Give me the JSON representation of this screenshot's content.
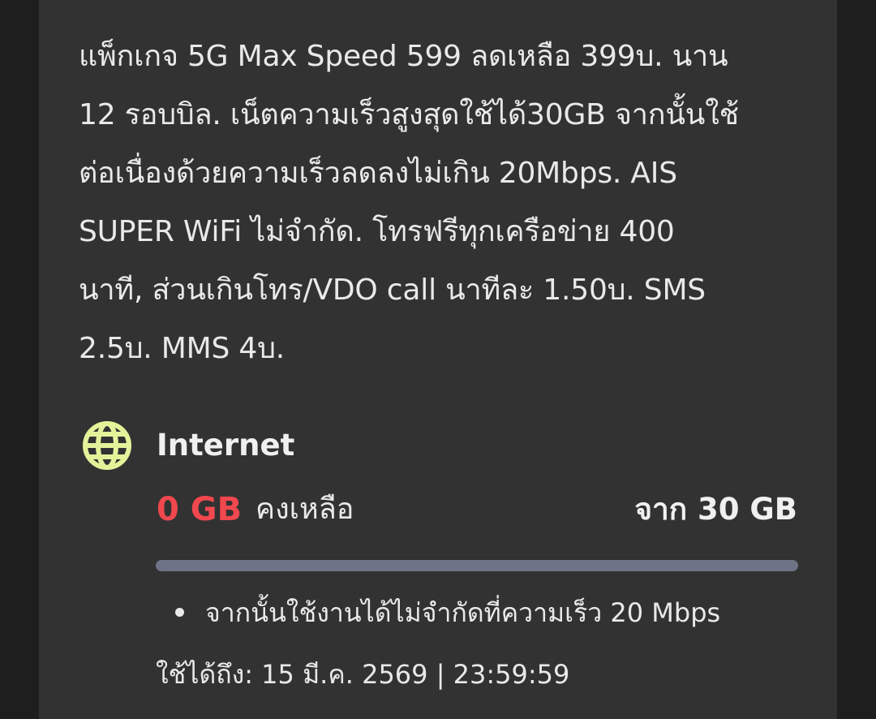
{
  "package": {
    "description": "แพ็กเกจ 5G Max Speed 599 ลดเหลือ 399บ. นาน\n12 รอบบิล. เน็ตความเร็วสูงสุดใช้ได้30GB จากนั้นใช้\nต่อเนื่องด้วยความเร็วลดลงไม่เกิน 20Mbps. AIS\nSUPER WiFi ไม่จำกัด. โทรฟรีทุกเครือข่าย 400\nนาที, ส่วนเกินโทร/VDO call นาทีละ 1.50บ. SMS\n2.5บ. MMS 4บ."
  },
  "internet": {
    "icon": "globe-icon",
    "title": "Internet",
    "remaining_value": "0 GB",
    "remaining_label": "คงเหลือ",
    "total_label": "จาก 30 GB",
    "remaining_fraction": 0,
    "bullet_text": "จากนั้นใช้งานได้ไม่จำกัดที่ความเร็ว 20 Mbps",
    "valid_until": "ใช้ได้ถึง: 15 มี.ค. 2569 | 23:59:59"
  },
  "colors": {
    "background": "#1e1e1e",
    "card": "#323232",
    "accent_red": "#f0484e",
    "globe": "#e4f29a",
    "track": "#6e7386",
    "text": "#e9e9e9"
  }
}
